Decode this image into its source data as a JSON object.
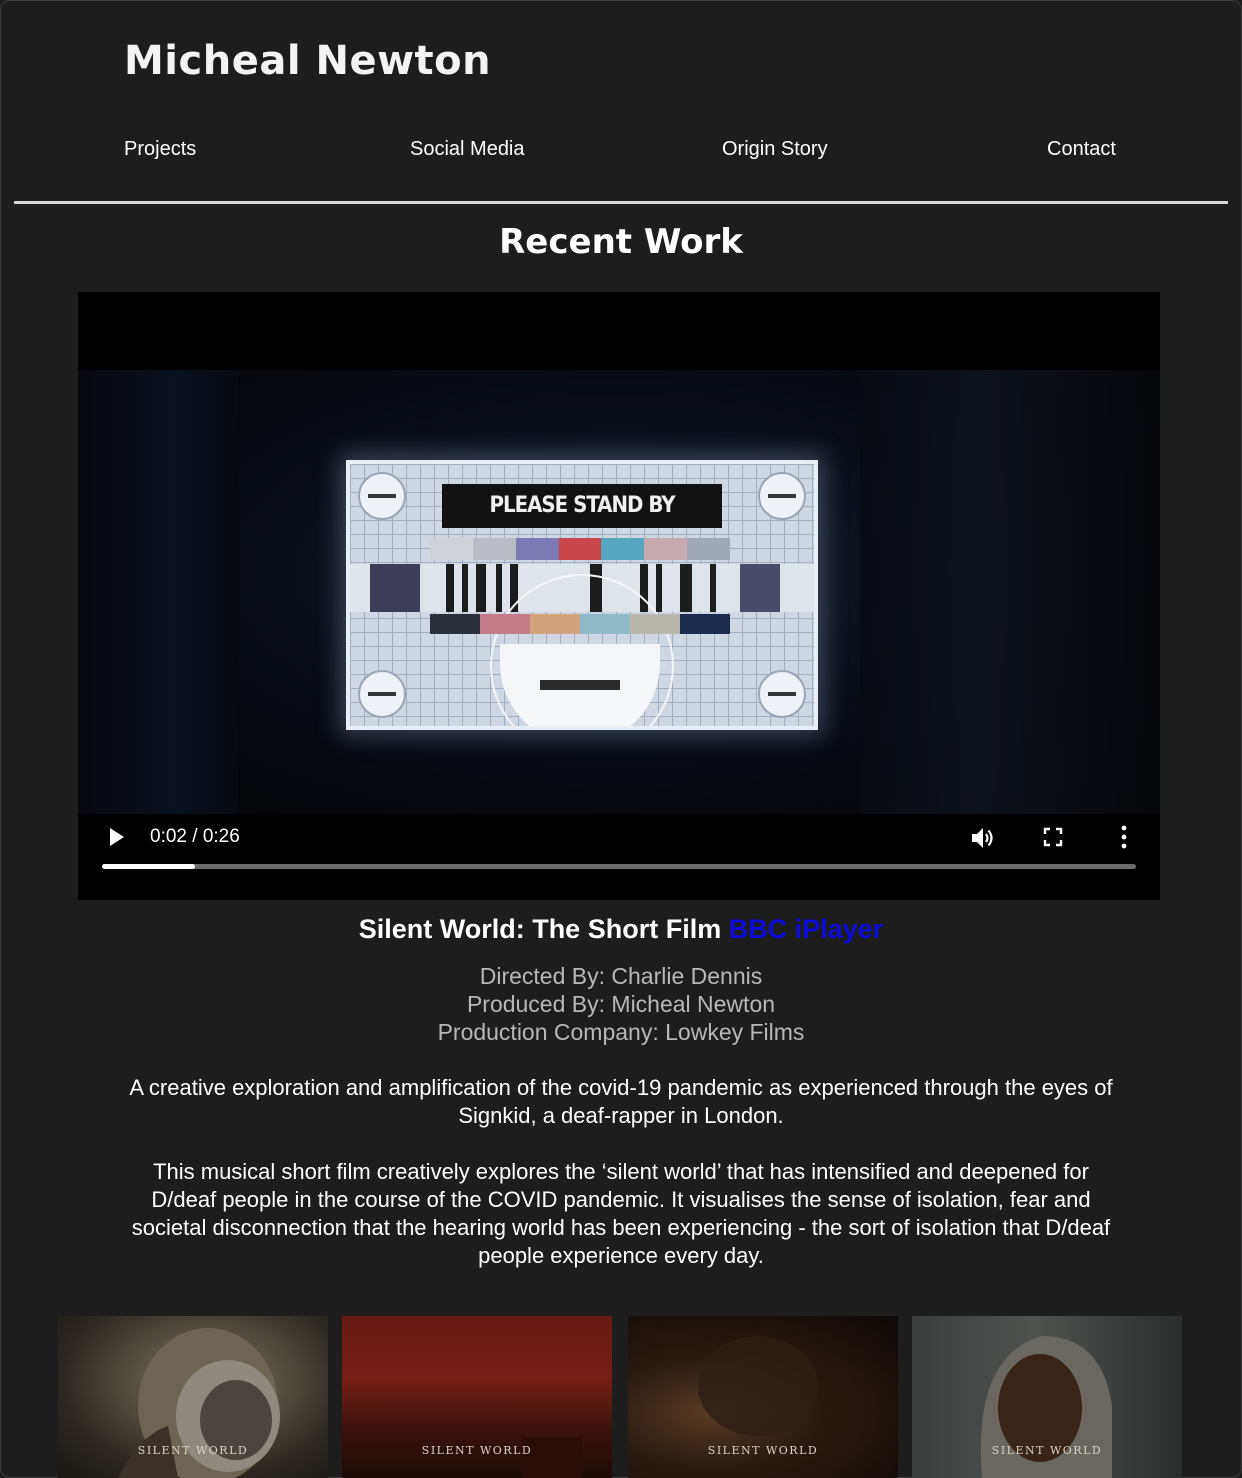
{
  "site": {
    "title": "Micheal Newton"
  },
  "nav": {
    "items": [
      {
        "label": "Projects"
      },
      {
        "label": "Social Media"
      },
      {
        "label": "Origin Story"
      },
      {
        "label": "Contact"
      }
    ]
  },
  "section": {
    "title": "Recent Work"
  },
  "video": {
    "frame_text": "PLEASE STAND BY",
    "time_display": "0:02 / 0:26",
    "progress_fraction": 0.09
  },
  "film": {
    "title": "Silent World: The Short Film",
    "link_label": "BBC iPlayer",
    "link_color": "#0e0bd9",
    "credits": [
      "Directed By: Charlie Dennis",
      "Produced By: Micheal Newton",
      "Production Company: Lowkey Films"
    ],
    "paragraphs": [
      "A creative exploration and amplification of the covid-19 pandemic as experienced through the eyes of Signkid, a deaf-rapper in London.",
      "This musical short film creatively explores the ‘silent world’ that has intensified and deepened for D/deaf people in the course of the COVID pandemic. It visualises the sense of isolation, fear and societal disconnection that the hearing world has been experiencing - the sort of isolation that D/deaf people experience every day."
    ]
  },
  "thumbnails": [
    {
      "caption": "SILENT WORLD"
    },
    {
      "caption": "SILENT WORLD"
    },
    {
      "caption": "SILENT WORLD"
    },
    {
      "caption": "SILENT WORLD"
    }
  ]
}
